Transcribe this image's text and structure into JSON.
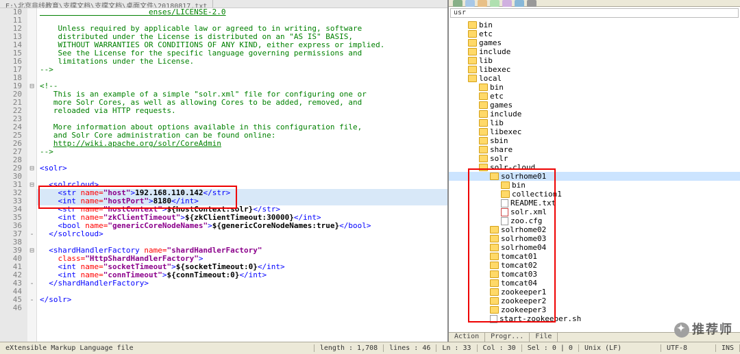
{
  "tab": {
    "path": "E:\\北京非线教育\\支撑文档\\支撑文档\\桌面文件\\20180817.txt"
  },
  "lines": [
    {
      "n": "10",
      "fold": "",
      "html": "<span class='c-lnk'>                        <u>enses/LICENSE-2.0</u></span>"
    },
    {
      "n": "11",
      "fold": "",
      "html": ""
    },
    {
      "n": "12",
      "fold": "",
      "html": "<span class='c-com'>    Unless required by applicable law or agreed to in writing, software</span>"
    },
    {
      "n": "13",
      "fold": "",
      "html": "<span class='c-com'>    distributed under the License is distributed on an \"AS IS\" BASIS,</span>"
    },
    {
      "n": "14",
      "fold": "",
      "html": "<span class='c-com'>    WITHOUT WARRANTIES OR CONDITIONS OF ANY KIND, either express or implied.</span>"
    },
    {
      "n": "15",
      "fold": "",
      "html": "<span class='c-com'>    See the License for the specific language governing permissions and</span>"
    },
    {
      "n": "16",
      "fold": "",
      "html": "<span class='c-com'>    limitations under the License.</span>"
    },
    {
      "n": "17",
      "fold": "",
      "html": "<span class='c-com'>--&gt;</span>"
    },
    {
      "n": "18",
      "fold": "",
      "html": ""
    },
    {
      "n": "19",
      "fold": "⊟",
      "html": "<span class='c-com'>&lt;!--</span>"
    },
    {
      "n": "20",
      "fold": "",
      "html": "<span class='c-com'>   This is an example of a simple \"solr.xml\" file for configuring one or</span>"
    },
    {
      "n": "21",
      "fold": "",
      "html": "<span class='c-com'>   more Solr Cores, as well as allowing Cores to be added, removed, and</span>"
    },
    {
      "n": "22",
      "fold": "",
      "html": "<span class='c-com'>   reloaded via HTTP requests.</span>"
    },
    {
      "n": "23",
      "fold": "",
      "html": ""
    },
    {
      "n": "24",
      "fold": "",
      "html": "<span class='c-com'>   More information about options available in this configuration file,</span>"
    },
    {
      "n": "25",
      "fold": "",
      "html": "<span class='c-com'>   and Solr Core administration can be found online:</span>"
    },
    {
      "n": "26",
      "fold": "",
      "html": "<span class='c-com'>   </span><span class='c-lnk'><u>http://wiki.apache.org/solr/CoreAdmin</u></span>"
    },
    {
      "n": "27",
      "fold": "",
      "html": "<span class='c-com'>--&gt;</span>"
    },
    {
      "n": "28",
      "fold": "",
      "html": ""
    },
    {
      "n": "29",
      "fold": "⊟",
      "html": "<span class='c-tag'>&lt;solr&gt;</span>"
    },
    {
      "n": "30",
      "fold": "",
      "html": ""
    },
    {
      "n": "31",
      "fold": "⊟",
      "html": "  <span class='c-tag'>&lt;solrcloud&gt;</span>"
    },
    {
      "n": "32",
      "fold": "",
      "sel": true,
      "html": "    <span class='c-tag'>&lt;str</span> <span class='c-attr'>name=</span><span class='c-str'>\"host\"</span><span class='c-tag'>&gt;</span><span class='c-txt'>192.168.110.142</span><span class='c-tag'>&lt;/str&gt;</span>"
    },
    {
      "n": "33",
      "fold": "",
      "sel": true,
      "html": "    <span class='c-tag'>&lt;int</span> <span class='c-attr'>name=</span><span class='c-str'>\"hostPort\"</span><span class='c-tag'>&gt;</span><span class='c-txt'>8180</span><span class='c-tag'>&lt;/int&gt;</span>"
    },
    {
      "n": "34",
      "fold": "",
      "html": "    <span class='c-tag'>&lt;str</span> <span class='c-attr'>name=</span><span class='c-str'>\"hostContext\"</span><span class='c-tag'>&gt;</span><span class='c-txt'>${hostContext:solr}</span><span class='c-tag'>&lt;/str&gt;</span>"
    },
    {
      "n": "35",
      "fold": "",
      "html": "    <span class='c-tag'>&lt;int</span> <span class='c-attr'>name=</span><span class='c-str'>\"zkClientTimeout\"</span><span class='c-tag'>&gt;</span><span class='c-txt'>${zkClientTimeout:30000}</span><span class='c-tag'>&lt;/int&gt;</span>"
    },
    {
      "n": "36",
      "fold": "",
      "html": "    <span class='c-tag'>&lt;bool</span> <span class='c-attr'>name=</span><span class='c-str'>\"genericCoreNodeNames\"</span><span class='c-tag'>&gt;</span><span class='c-txt'>${genericCoreNodeNames:true}</span><span class='c-tag'>&lt;/bool&gt;</span>"
    },
    {
      "n": "37",
      "fold": "-",
      "html": "  <span class='c-tag'>&lt;/solrcloud&gt;</span>"
    },
    {
      "n": "38",
      "fold": "",
      "html": ""
    },
    {
      "n": "39",
      "fold": "⊟",
      "html": "  <span class='c-tag'>&lt;shardHandlerFactory</span> <span class='c-attr'>name=</span><span class='c-str'>\"shardHandlerFactory\"</span>"
    },
    {
      "n": "40",
      "fold": "",
      "html": "    <span class='c-attr'>class=</span><span class='c-str'>\"HttpShardHandlerFactory\"</span><span class='c-tag'>&gt;</span>"
    },
    {
      "n": "41",
      "fold": "",
      "html": "    <span class='c-tag'>&lt;int</span> <span class='c-attr'>name=</span><span class='c-str'>\"socketTimeout\"</span><span class='c-tag'>&gt;</span><span class='c-txt'>${socketTimeout:0}</span><span class='c-tag'>&lt;/int&gt;</span>"
    },
    {
      "n": "42",
      "fold": "",
      "html": "    <span class='c-tag'>&lt;int</span> <span class='c-attr'>name=</span><span class='c-str'>\"connTimeout\"</span><span class='c-tag'>&gt;</span><span class='c-txt'>${connTimeout:0}</span><span class='c-tag'>&lt;/int&gt;</span>"
    },
    {
      "n": "43",
      "fold": "-",
      "html": "  <span class='c-tag'>&lt;/shardHandlerFactory&gt;</span>"
    },
    {
      "n": "44",
      "fold": "",
      "html": ""
    },
    {
      "n": "45",
      "fold": "-",
      "html": "<span class='c-tag'>&lt;/solr&gt;</span>"
    },
    {
      "n": "46",
      "fold": "",
      "html": ""
    }
  ],
  "pathbar": "usr",
  "tree": [
    {
      "d": 1,
      "t": "f",
      "l": "bin"
    },
    {
      "d": 1,
      "t": "f",
      "l": "etc"
    },
    {
      "d": 1,
      "t": "f",
      "l": "games"
    },
    {
      "d": 1,
      "t": "f",
      "l": "include"
    },
    {
      "d": 1,
      "t": "f",
      "l": "lib"
    },
    {
      "d": 1,
      "t": "f",
      "l": "libexec"
    },
    {
      "d": 1,
      "t": "f",
      "l": "local",
      "open": true
    },
    {
      "d": 2,
      "t": "f",
      "l": "bin"
    },
    {
      "d": 2,
      "t": "f",
      "l": "etc"
    },
    {
      "d": 2,
      "t": "f",
      "l": "games"
    },
    {
      "d": 2,
      "t": "f",
      "l": "include"
    },
    {
      "d": 2,
      "t": "f",
      "l": "lib"
    },
    {
      "d": 2,
      "t": "f",
      "l": "libexec"
    },
    {
      "d": 2,
      "t": "f",
      "l": "sbin"
    },
    {
      "d": 2,
      "t": "f",
      "l": "share"
    },
    {
      "d": 2,
      "t": "f",
      "l": "solr"
    },
    {
      "d": 2,
      "t": "f",
      "l": "solr-cloud",
      "open": true
    },
    {
      "d": 3,
      "t": "f",
      "l": "solrhome01",
      "sel": true,
      "open": true
    },
    {
      "d": 4,
      "t": "f",
      "l": "bin"
    },
    {
      "d": 4,
      "t": "f",
      "l": "collection1"
    },
    {
      "d": 4,
      "t": "x",
      "l": "README.txt"
    },
    {
      "d": 4,
      "t": "xml",
      "l": "solr.xml"
    },
    {
      "d": 4,
      "t": "x",
      "l": "zoo.cfg"
    },
    {
      "d": 3,
      "t": "f",
      "l": "solrhome02"
    },
    {
      "d": 3,
      "t": "f",
      "l": "solrhome03"
    },
    {
      "d": 3,
      "t": "f",
      "l": "solrhome04"
    },
    {
      "d": 3,
      "t": "f",
      "l": "tomcat01"
    },
    {
      "d": 3,
      "t": "f",
      "l": "tomcat02"
    },
    {
      "d": 3,
      "t": "f",
      "l": "tomcat03"
    },
    {
      "d": 3,
      "t": "f",
      "l": "tomcat04"
    },
    {
      "d": 3,
      "t": "f",
      "l": "zookeeper1"
    },
    {
      "d": 3,
      "t": "f",
      "l": "zookeeper2"
    },
    {
      "d": 3,
      "t": "f",
      "l": "zookeeper3"
    },
    {
      "d": 3,
      "t": "x",
      "l": "start-zookeeper.sh"
    }
  ],
  "bottom_tabs": [
    "Action",
    "Progr...",
    "File"
  ],
  "status": {
    "filetype": "eXtensible Markup Language file",
    "length": "length : 1,708",
    "lines": "lines : 46",
    "ln": "Ln : 33",
    "col": "Col : 30",
    "sel": "Sel : 0 | 0",
    "eol": "Unix (LF)",
    "enc": "UTF-8",
    "ins": "INS"
  },
  "watermark": "推荐师"
}
